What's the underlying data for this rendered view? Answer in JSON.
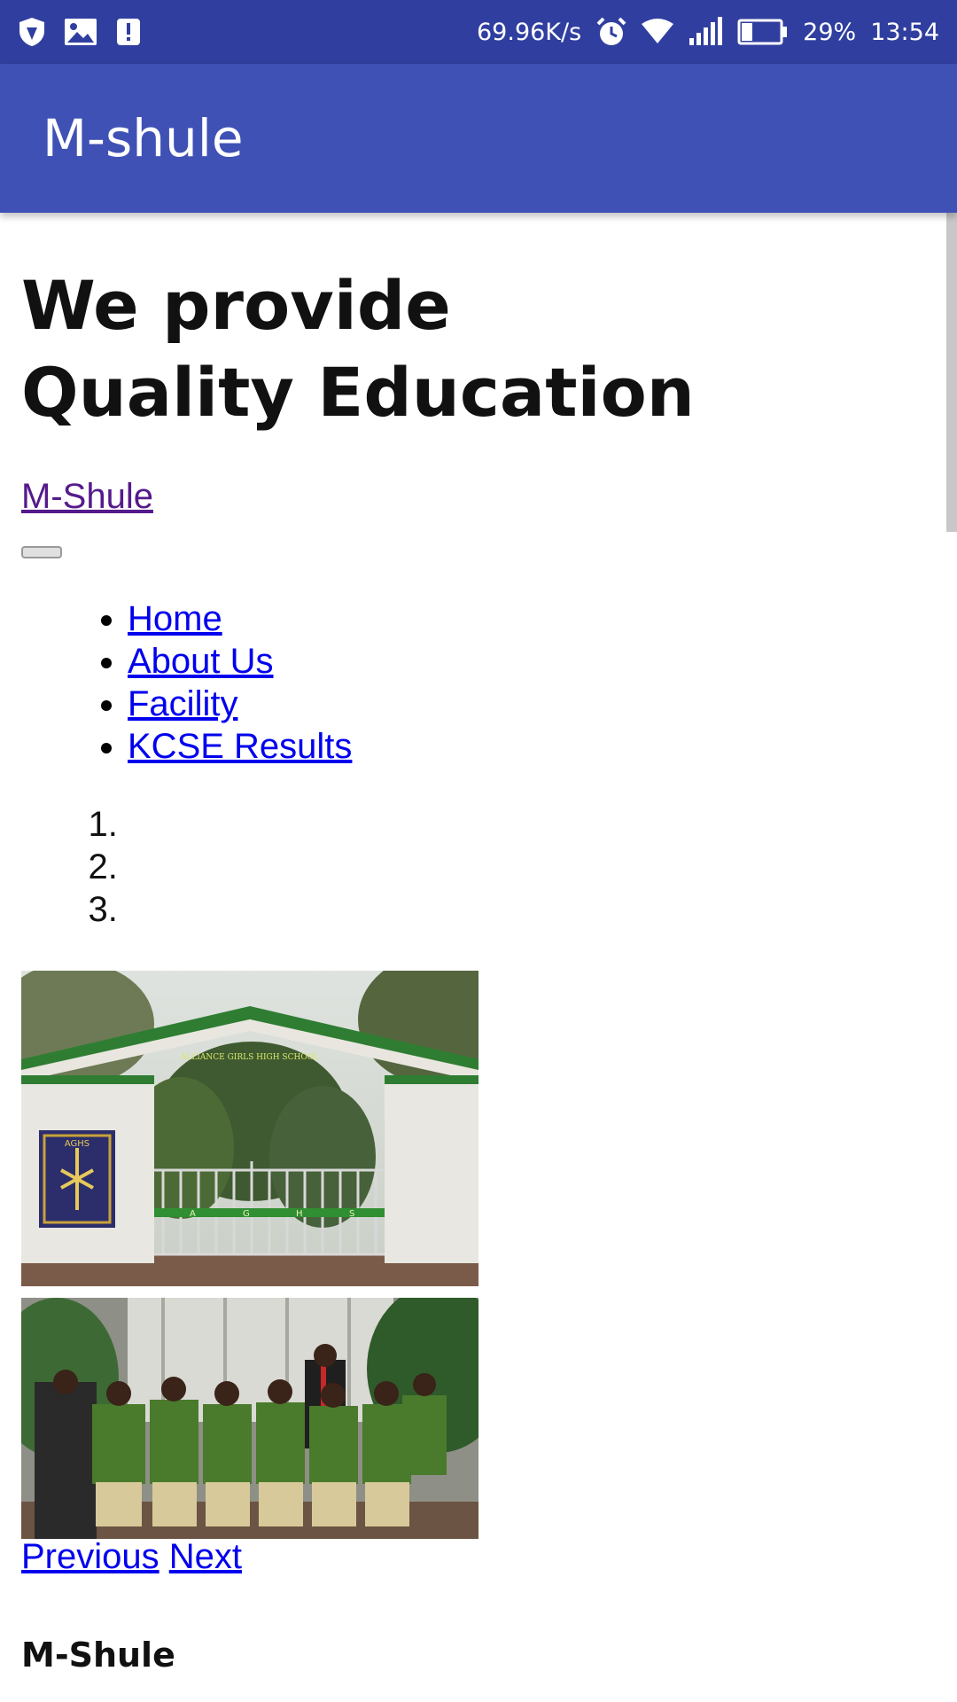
{
  "status_bar": {
    "network_speed": "69.96K/s",
    "battery": "29%",
    "time": "13:54"
  },
  "app_bar": {
    "title": "M-shule"
  },
  "page": {
    "hero_title": "We provide Quality Education",
    "brand_link": "M-Shule",
    "nav_items": [
      "Home",
      "About Us",
      "Facility",
      "KCSE Results"
    ],
    "carousel": {
      "indicator_count": 3,
      "gate_sign": "ALLIANCE GIRLS HIGH SCHOOL",
      "gate_letters": [
        "A",
        "G",
        "H",
        "S"
      ],
      "crest_text": "AGHS",
      "previous_label": "Previous",
      "next_label": "Next"
    },
    "footer_brand": "M-Shule"
  }
}
